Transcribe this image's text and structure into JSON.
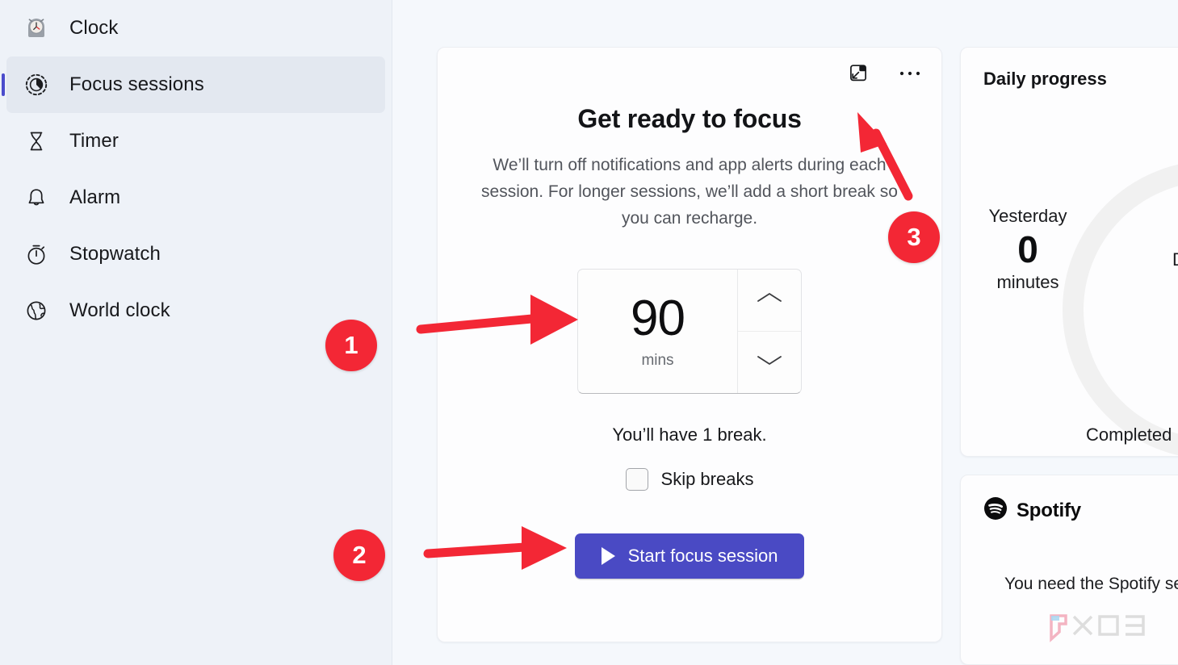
{
  "app": {
    "name": "Clock"
  },
  "sidebar": {
    "items": [
      {
        "label": "Clock",
        "icon": "clock-app-icon",
        "selected": false
      },
      {
        "label": "Focus sessions",
        "icon": "focus-sessions-icon",
        "selected": true
      },
      {
        "label": "Timer",
        "icon": "hourglass-icon",
        "selected": false
      },
      {
        "label": "Alarm",
        "icon": "bell-icon",
        "selected": false
      },
      {
        "label": "Stopwatch",
        "icon": "stopwatch-icon",
        "selected": false
      },
      {
        "label": "World clock",
        "icon": "globe-icon",
        "selected": false
      }
    ]
  },
  "focus_card": {
    "title": "Get ready to focus",
    "description": "We’ll turn off notifications and app alerts during each session. For longer sessions, we’ll add a short break so you can recharge.",
    "mini_view_icon": "mini-view-icon",
    "more_options_icon": "more-options-icon",
    "duration": {
      "value": "90",
      "unit": "mins",
      "increase_icon": "chevron-up-icon",
      "decrease_icon": "chevron-down-icon"
    },
    "break_text": "You’ll have 1 break.",
    "skip_breaks_label": "Skip breaks",
    "skip_breaks_checked": false,
    "start_button_label": "Start focus session",
    "start_button_icon": "play-icon",
    "start_button_color": "#4a4ac4"
  },
  "daily_progress": {
    "title": "Daily progress",
    "yesterday_label": "Yesterday",
    "yesterday_value": "0",
    "yesterday_unit": "minutes",
    "day_label": "D",
    "completed_label": "Completed",
    "ring_color": "#f1f1f1"
  },
  "spotify_card": {
    "brand": "Spotify",
    "brand_icon": "spotify-icon",
    "body": "You need the Spotify sessions with"
  },
  "annotations": {
    "accent_color": "#f32735",
    "markers": [
      {
        "number": "1",
        "target": "duration-spinner"
      },
      {
        "number": "2",
        "target": "start-focus-session-button"
      },
      {
        "number": "3",
        "target": "mini-view-button"
      }
    ]
  }
}
